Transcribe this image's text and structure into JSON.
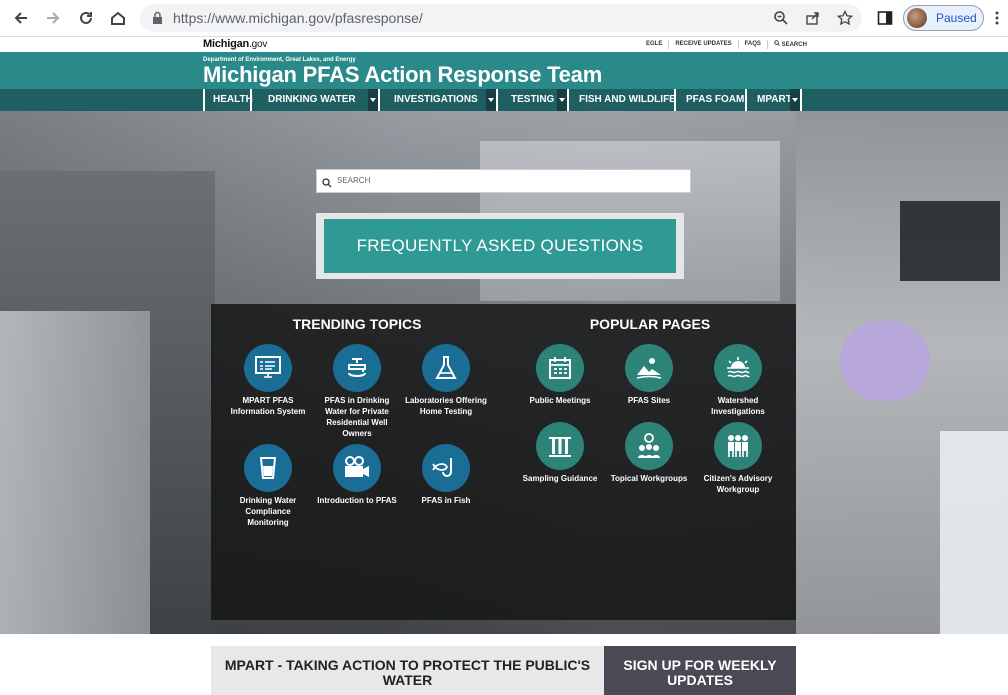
{
  "browser": {
    "url": "https://www.michigan.gov/pfasresponse/",
    "profile_label": "Paused"
  },
  "site": {
    "logo_main": "Michigan",
    "logo_suffix": ".gov",
    "utility_links": [
      "EGLE",
      "RECEIVE UPDATES",
      "FAQS",
      "SEARCH"
    ],
    "department": "Department of Environment, Great Lakes, and Energy",
    "title": "Michigan PFAS Action Response Team"
  },
  "nav": {
    "items": [
      {
        "label": "HEALTH",
        "dropdown": false
      },
      {
        "label": "DRINKING WATER",
        "dropdown": true
      },
      {
        "label": "INVESTIGATIONS",
        "dropdown": true
      },
      {
        "label": "TESTING",
        "dropdown": true
      },
      {
        "label": "FISH AND WILDLIFE",
        "dropdown": false
      },
      {
        "label": "PFAS FOAM",
        "dropdown": false
      },
      {
        "label": "MPART",
        "dropdown": true
      }
    ]
  },
  "hero": {
    "search_placeholder": "SEARCH",
    "faq_label": "FREQUENTLY ASKED QUESTIONS"
  },
  "trending": {
    "title": "TRENDING TOPICS",
    "items": [
      {
        "label": "MPART PFAS Information System",
        "icon": "monitor-list-icon"
      },
      {
        "label": "PFAS in Drinking Water for Private Residential Well Owners",
        "icon": "faucet-icon"
      },
      {
        "label": "Laboratories Offering Home Testing",
        "icon": "flask-icon"
      },
      {
        "label": "Drinking Water Compliance Monitoring",
        "icon": "water-glass-icon"
      },
      {
        "label": "Introduction to PFAS",
        "icon": "video-camera-icon"
      },
      {
        "label": "PFAS in Fish",
        "icon": "fish-hook-icon"
      }
    ]
  },
  "popular": {
    "title": "POPULAR PAGES",
    "items": [
      {
        "label": "Public Meetings",
        "icon": "calendar-icon"
      },
      {
        "label": "PFAS Sites",
        "icon": "landscape-icon"
      },
      {
        "label": "Watershed Investigations",
        "icon": "sunset-water-icon"
      },
      {
        "label": "Sampling Guidance",
        "icon": "test-tubes-icon"
      },
      {
        "label": "Topical Workgroups",
        "icon": "group-idea-icon"
      },
      {
        "label": "Citizen's Advisory Workgroup",
        "icon": "people-icon"
      }
    ]
  },
  "bottom": {
    "left_label": "MPART - TAKING ACTION TO PROTECT THE PUBLIC'S WATER",
    "right_label": "SIGN UP FOR WEEKLY UPDATES"
  }
}
